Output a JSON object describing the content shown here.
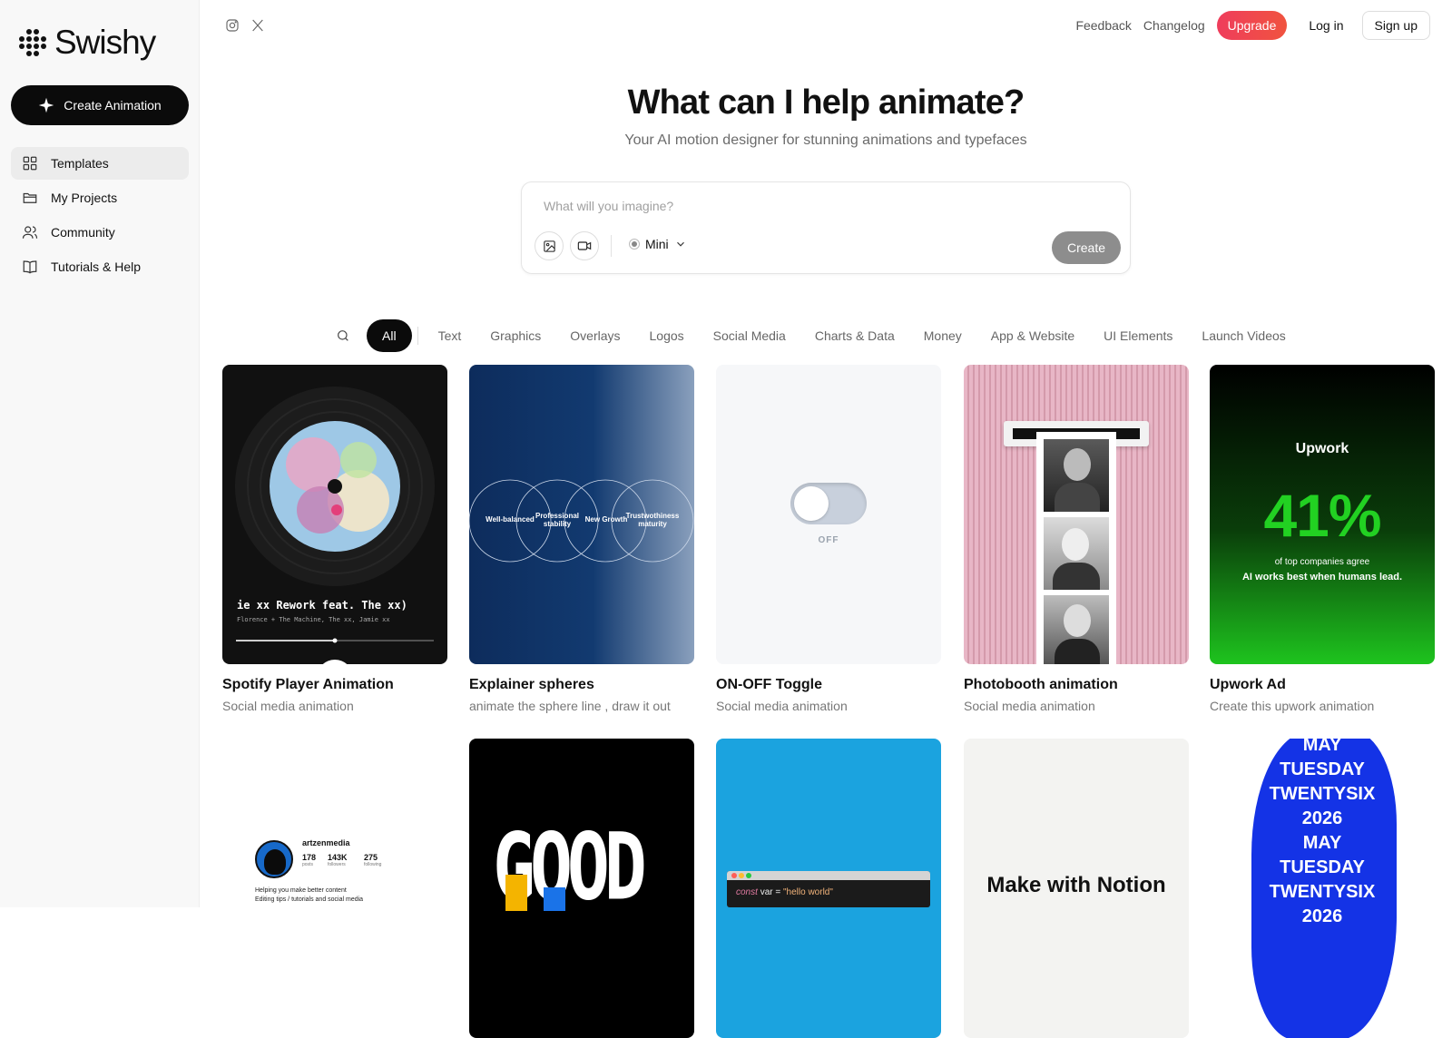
{
  "brand": {
    "name": "Swishy"
  },
  "sidebar": {
    "create_label": "Create Animation",
    "items": [
      {
        "label": "Templates",
        "icon": "grid-icon",
        "active": true
      },
      {
        "label": "My Projects",
        "icon": "folder-icon"
      },
      {
        "label": "Community",
        "icon": "users-icon"
      },
      {
        "label": "Tutorials & Help",
        "icon": "book-icon"
      }
    ]
  },
  "topbar": {
    "feedback": "Feedback",
    "changelog": "Changelog",
    "upgrade": "Upgrade",
    "login": "Log in",
    "signup": "Sign up"
  },
  "hero": {
    "title": "What can I help animate?",
    "subtitle": "Your AI motion designer for stunning animations and typefaces"
  },
  "prompt": {
    "placeholder": "What will you imagine?",
    "model": "Mini",
    "create": "Create"
  },
  "filters": [
    "All",
    "Text",
    "Graphics",
    "Overlays",
    "Logos",
    "Social Media",
    "Charts & Data",
    "Money",
    "App & Website",
    "UI Elements",
    "Launch Videos"
  ],
  "cards": [
    {
      "title": "Spotify Player Animation",
      "subtitle": "Social media animation",
      "preview": {
        "track": "ie xx Rework feat. The xx)",
        "artists": "Florence + The Machine, The xx, Jamie xx",
        "progress": 0.5
      }
    },
    {
      "title": "Explainer spheres",
      "subtitle": "animate the sphere line , draw it out",
      "preview": {
        "labels": [
          "Well-balanced",
          "Professional stability",
          "New Growth",
          "Trustwothiness maturity"
        ]
      }
    },
    {
      "title": "ON-OFF Toggle",
      "subtitle": "Social media animation",
      "preview": {
        "state": "OFF"
      }
    },
    {
      "title": "Photobooth animation",
      "subtitle": "Social media animation"
    },
    {
      "title": "Upwork Ad",
      "subtitle": "Create this upwork animation",
      "preview": {
        "brand": "Upwork",
        "stat": "41%",
        "line1": "of top companies agree",
        "line2": "AI works best when humans lead."
      }
    }
  ],
  "row2": {
    "profile": {
      "handle": "artzenmedia",
      "posts": "178",
      "posts_label": "posts",
      "followers": "143K",
      "followers_label": "followers",
      "following": "275",
      "following_label": "following",
      "bio1": "Helping you make better content",
      "bio2": "Editing tips / tutorials and social media"
    },
    "good": "GOOD",
    "code": {
      "kw": "const",
      "var": "var",
      "eq": "=",
      "str": "\"hello world\""
    },
    "notion": "Make with Notion",
    "date_lines": [
      "MAY",
      "TUESDAY",
      "TWENTYSIX",
      "2026",
      "MAY",
      "TUESDAY",
      "TWENTYSIX",
      "2026"
    ]
  }
}
